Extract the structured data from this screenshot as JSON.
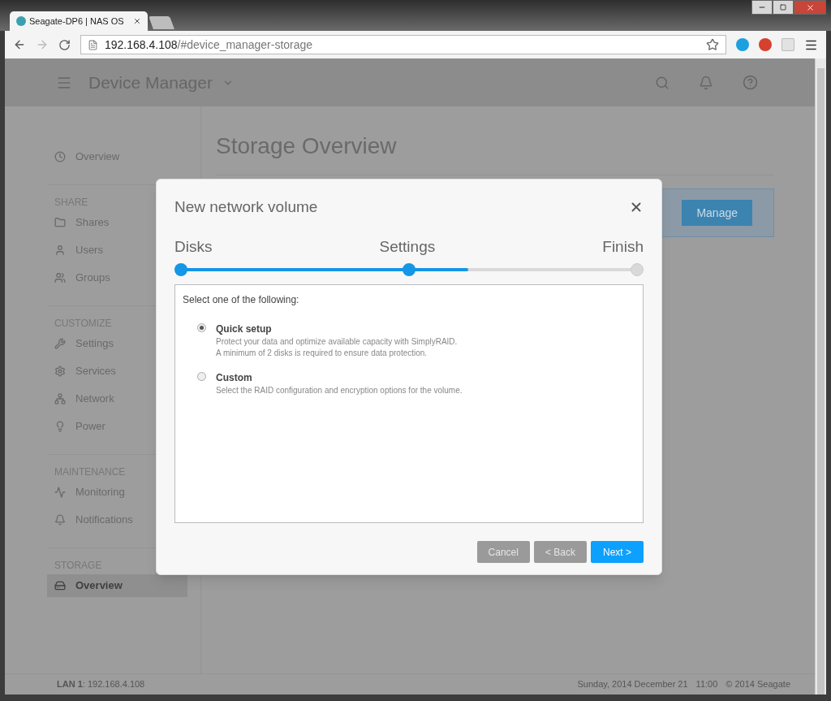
{
  "browser": {
    "tab_title": "Seagate-DP6 | NAS OS",
    "url_host": "192.168.4.108",
    "url_path": "/#device_manager-storage"
  },
  "header": {
    "title": "Device Manager"
  },
  "sidebar": {
    "top_items": [
      {
        "label": "Overview",
        "selected": false
      }
    ],
    "sections": [
      {
        "title": "SHARE",
        "items": [
          {
            "label": "Shares",
            "selected": false
          },
          {
            "label": "Users",
            "selected": false
          },
          {
            "label": "Groups",
            "selected": false
          }
        ]
      },
      {
        "title": "CUSTOMIZE",
        "items": [
          {
            "label": "Settings",
            "selected": false
          },
          {
            "label": "Services",
            "selected": false
          },
          {
            "label": "Network",
            "selected": false
          },
          {
            "label": "Power",
            "selected": false
          }
        ]
      },
      {
        "title": "MAINTENANCE",
        "items": [
          {
            "label": "Monitoring",
            "selected": false
          },
          {
            "label": "Notifications",
            "selected": false
          }
        ]
      },
      {
        "title": "STORAGE",
        "items": [
          {
            "label": "Overview",
            "selected": true
          }
        ]
      }
    ]
  },
  "main": {
    "title": "Storage Overview",
    "manage_button": "Manage"
  },
  "dialog": {
    "title": "New network volume",
    "steps": [
      {
        "label": "Disks",
        "reached": true
      },
      {
        "label": "Settings",
        "reached": true
      },
      {
        "label": "Finish",
        "reached": false
      }
    ],
    "progress": {
      "level": 0.63
    },
    "prompt": "Select one of the following:",
    "options": [
      {
        "title": "Quick setup",
        "selected": true,
        "description": [
          "Protect your data and optimize available capacity with SimplyRAID.",
          "A minimum of 2 disks is required to ensure data protection."
        ]
      },
      {
        "title": "Custom",
        "selected": false,
        "description": [
          "Select the RAID configuration and encryption options for the volume."
        ]
      }
    ],
    "buttons": [
      {
        "label": "Cancel",
        "kind": "secondary"
      },
      {
        "label": "< Back",
        "kind": "secondary"
      },
      {
        "label": "Next >",
        "kind": "primary"
      }
    ]
  },
  "status_bar": {
    "lan": "**LAN 1**: 192.168.4.108",
    "date": "Sunday, 2014 December 21",
    "time": "11:00",
    "copyright": "© 2014 Seagate"
  }
}
